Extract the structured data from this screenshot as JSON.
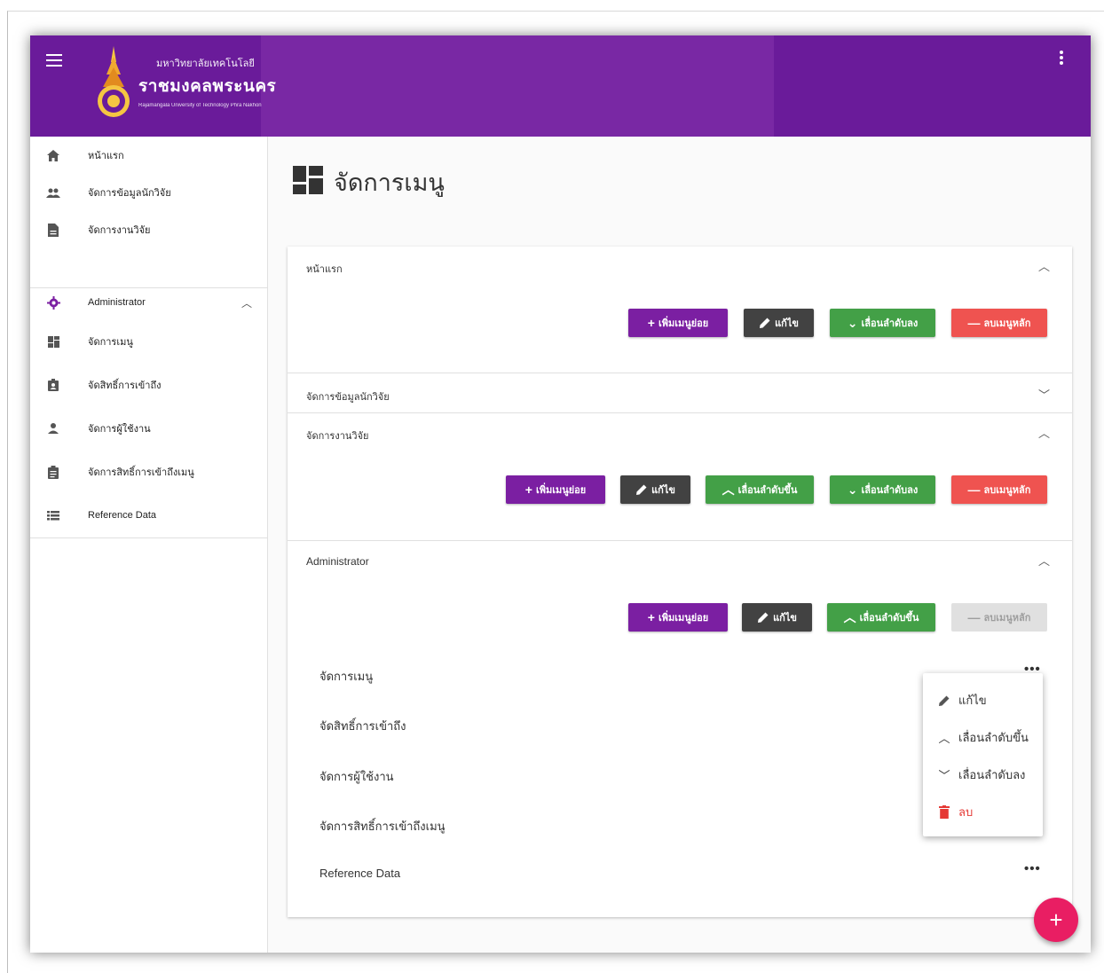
{
  "brand": {
    "university_th": "มหาวิทยาลัยเทคโนโลยี",
    "name_th": "ราชมงคลพระนคร",
    "university_en": "Rajamangala University of Technology Phra Nakhon"
  },
  "sidebar": {
    "items": [
      {
        "label": "หน้าแรก",
        "icon": "home-icon"
      },
      {
        "label": "จัดการข้อมูลนักวิจัย",
        "icon": "people-icon"
      },
      {
        "label": "จัดการงานวิจัย",
        "icon": "document-icon"
      },
      {
        "label": "Administrator",
        "icon": "gear-icon"
      },
      {
        "label": "จัดการเมนู",
        "icon": "dashboard-icon"
      },
      {
        "label": "จัดสิทธิ์การเข้าถึง",
        "icon": "badge-icon"
      },
      {
        "label": "จัดการผู้ใช้งาน",
        "icon": "person-icon"
      },
      {
        "label": "จัดการสิทธิ์การเข้าถึงเมนู",
        "icon": "assignment-icon"
      },
      {
        "label": "Reference Data",
        "icon": "list-icon"
      }
    ]
  },
  "main": {
    "title": "จัดการเมนู",
    "panels": [
      {
        "header": "หน้าแรก"
      },
      {
        "header": "จัดการข้อมูลนักวิจัย"
      },
      {
        "header": "จัดการงานวิจัย"
      },
      {
        "header": "Administrator"
      }
    ],
    "buttons": {
      "add_sub": "เพิ่มเมนูย่อย",
      "edit": "แก้ไข",
      "move_up": "เลื่อนลำดับขึ้น",
      "move_down": "เลื่อนลำดับลง",
      "delete_main": "ลบเมนูหลัก"
    },
    "admin_sub_items": [
      "จัดการเมนู",
      "จัดสิทธิ์การเข้าถึง",
      "จัดการผู้ใช้งาน",
      "จัดการสิทธิ์การเข้าถึงเมนู",
      "Reference Data"
    ]
  },
  "context_menu": {
    "edit": "แก้ไข",
    "move_up": "เลื่อนลำดับขึ้น",
    "move_down": "เลื่อนลำดับลง",
    "delete": "ลบ"
  },
  "colors": {
    "appbar": "#6a1b9a",
    "purple_button": "#7b1fa2",
    "green_button": "#43a047",
    "red_button": "#ef5350",
    "fab": "#e91e63"
  },
  "fab": {
    "label": "+"
  }
}
